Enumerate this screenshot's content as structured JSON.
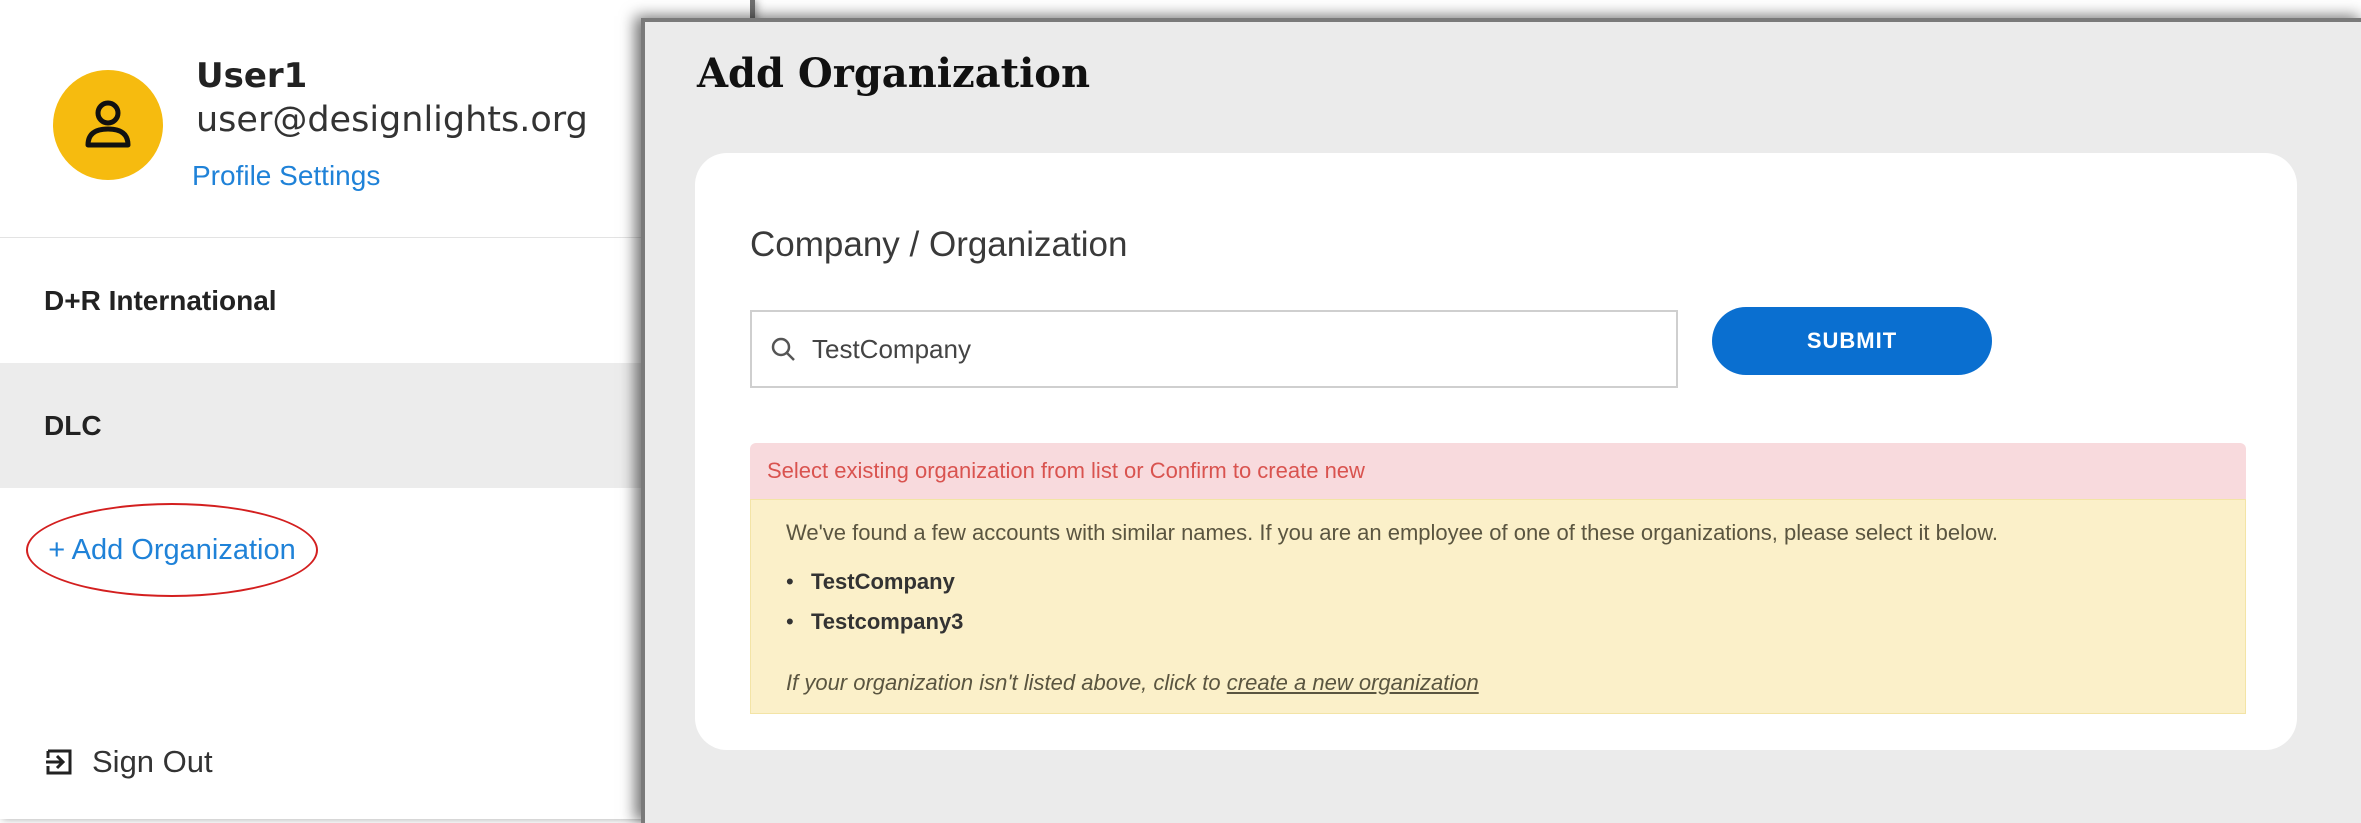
{
  "user": {
    "name": "User1",
    "email": "user@designlights.org",
    "profile_link": "Profile Settings",
    "avatar_icon": "user-icon",
    "avatar_color": "#f6bb0f"
  },
  "sidebar": {
    "orgs": [
      {
        "label": "D+R International"
      },
      {
        "label": "DLC"
      }
    ],
    "add_org_label": "+ Add Organization",
    "signout_label": "Sign Out",
    "signout_icon": "sign-out-icon"
  },
  "main": {
    "title": "Add Organization",
    "field_label": "Company / Organization",
    "search": {
      "value": "TestCompany",
      "icon": "search-icon"
    },
    "submit_label": "SUBMIT",
    "error_message": "Select existing organization from list or Confirm to create new",
    "warning_message": "We've found a few accounts with similar names. If you are an employee of one of these organizations, please select it below.",
    "suggestions": [
      {
        "label": "TestCompany"
      },
      {
        "label": "Testcompany3"
      }
    ],
    "create_prefix": "If your organization isn't listed above, click to",
    "create_link": "create a new organization"
  },
  "colors": {
    "accent": "#1f82d8",
    "submit": "#0a6fd0",
    "error_bg": "#f8dadd",
    "error_text": "#d9534f",
    "warning_bg": "#fbf0c9",
    "highlight_circle": "#d31f1f"
  }
}
